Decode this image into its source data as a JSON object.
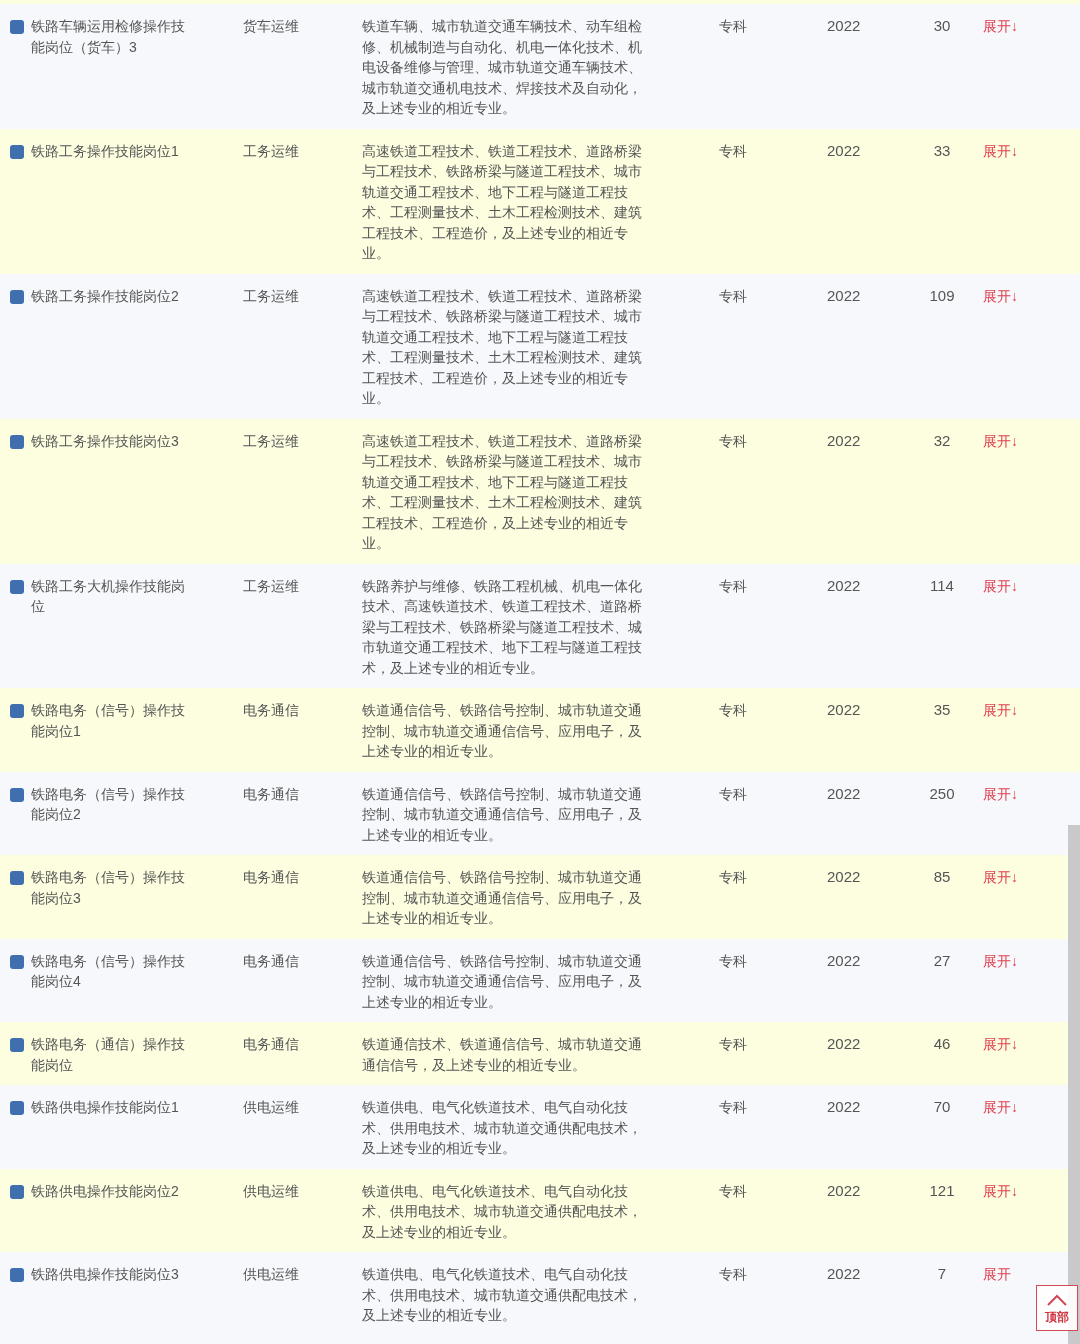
{
  "rows": [
    {
      "name": "铁路车辆运用检修操作技能岗位（货车）3",
      "category": "货车运维",
      "majors": "铁道车辆、城市轨道交通车辆技术、动车组检修、机械制造与自动化、机电一体化技术、机电设备维修与管理、城市轨道交通车辆技术、城市轨道交通机电技术、焊接技术及自动化，及上述专业的相近专业。",
      "level": "专科",
      "year": "2022",
      "count": "30",
      "toggle": "展开↓"
    },
    {
      "name": "铁路工务操作技能岗位1",
      "category": "工务运维",
      "majors": "高速铁道工程技术、铁道工程技术、道路桥梁与工程技术、铁路桥梁与隧道工程技术、城市轨道交通工程技术、地下工程与隧道工程技术、工程测量技术、土木工程检测技术、建筑工程技术、工程造价，及上述专业的相近专业。",
      "level": "专科",
      "year": "2022",
      "count": "33",
      "toggle": "展开↓"
    },
    {
      "name": "铁路工务操作技能岗位2",
      "category": "工务运维",
      "majors": "高速铁道工程技术、铁道工程技术、道路桥梁与工程技术、铁路桥梁与隧道工程技术、城市轨道交通工程技术、地下工程与隧道工程技术、工程测量技术、土木工程检测技术、建筑工程技术、工程造价，及上述专业的相近专业。",
      "level": "专科",
      "year": "2022",
      "count": "109",
      "toggle": "展开↓"
    },
    {
      "name": "铁路工务操作技能岗位3",
      "category": "工务运维",
      "majors": "高速铁道工程技术、铁道工程技术、道路桥梁与工程技术、铁路桥梁与隧道工程技术、城市轨道交通工程技术、地下工程与隧道工程技术、工程测量技术、土木工程检测技术、建筑工程技术、工程造价，及上述专业的相近专业。",
      "level": "专科",
      "year": "2022",
      "count": "32",
      "toggle": "展开↓"
    },
    {
      "name": "铁路工务大机操作技能岗位",
      "category": "工务运维",
      "majors": "铁路养护与维修、铁路工程机械、机电一体化技术、高速铁道技术、铁道工程技术、道路桥梁与工程技术、铁路桥梁与隧道工程技术、城市轨道交通工程技术、地下工程与隧道工程技术，及上述专业的相近专业。",
      "level": "专科",
      "year": "2022",
      "count": "114",
      "toggle": "展开↓"
    },
    {
      "name": "铁路电务（信号）操作技能岗位1",
      "category": "电务通信",
      "majors": "铁道通信信号、铁路信号控制、城市轨道交通控制、城市轨道交通通信信号、应用电子，及上述专业的相近专业。",
      "level": "专科",
      "year": "2022",
      "count": "35",
      "toggle": "展开↓"
    },
    {
      "name": "铁路电务（信号）操作技能岗位2",
      "category": "电务通信",
      "majors": "铁道通信信号、铁路信号控制、城市轨道交通控制、城市轨道交通通信信号、应用电子，及上述专业的相近专业。",
      "level": "专科",
      "year": "2022",
      "count": "250",
      "toggle": "展开↓"
    },
    {
      "name": "铁路电务（信号）操作技能岗位3",
      "category": "电务通信",
      "majors": "铁道通信信号、铁路信号控制、城市轨道交通控制、城市轨道交通通信信号、应用电子，及上述专业的相近专业。",
      "level": "专科",
      "year": "2022",
      "count": "85",
      "toggle": "展开↓"
    },
    {
      "name": "铁路电务（信号）操作技能岗位4",
      "category": "电务通信",
      "majors": "铁道通信信号、铁路信号控制、城市轨道交通控制、城市轨道交通通信信号、应用电子，及上述专业的相近专业。",
      "level": "专科",
      "year": "2022",
      "count": "27",
      "toggle": "展开↓"
    },
    {
      "name": "铁路电务（通信）操作技能岗位",
      "category": "电务通信",
      "majors": "铁道通信技术、铁道通信信号、城市轨道交通通信信号，及上述专业的相近专业。",
      "level": "专科",
      "year": "2022",
      "count": "46",
      "toggle": "展开↓"
    },
    {
      "name": "铁路供电操作技能岗位1",
      "category": "供电运维",
      "majors": "铁道供电、电气化铁道技术、电气自动化技术、供用电技术、城市轨道交通供配电技术，及上述专业的相近专业。",
      "level": "专科",
      "year": "2022",
      "count": "70",
      "toggle": "展开↓"
    },
    {
      "name": "铁路供电操作技能岗位2",
      "category": "供电运维",
      "majors": "铁道供电、电气化铁道技术、电气自动化技术、供用电技术、城市轨道交通供配电技术，及上述专业的相近专业。",
      "level": "专科",
      "year": "2022",
      "count": "121",
      "toggle": "展开↓"
    },
    {
      "name": "铁路供电操作技能岗位3",
      "category": "供电运维",
      "majors": "铁道供电、电气化铁道技术、电气自动化技术、供用电技术、城市轨道交通供配电技术，及上述专业的相近专业。",
      "level": "专科",
      "year": "2022",
      "count": "7",
      "toggle": "展开"
    }
  ],
  "back_to_top": {
    "label": "顶部"
  }
}
